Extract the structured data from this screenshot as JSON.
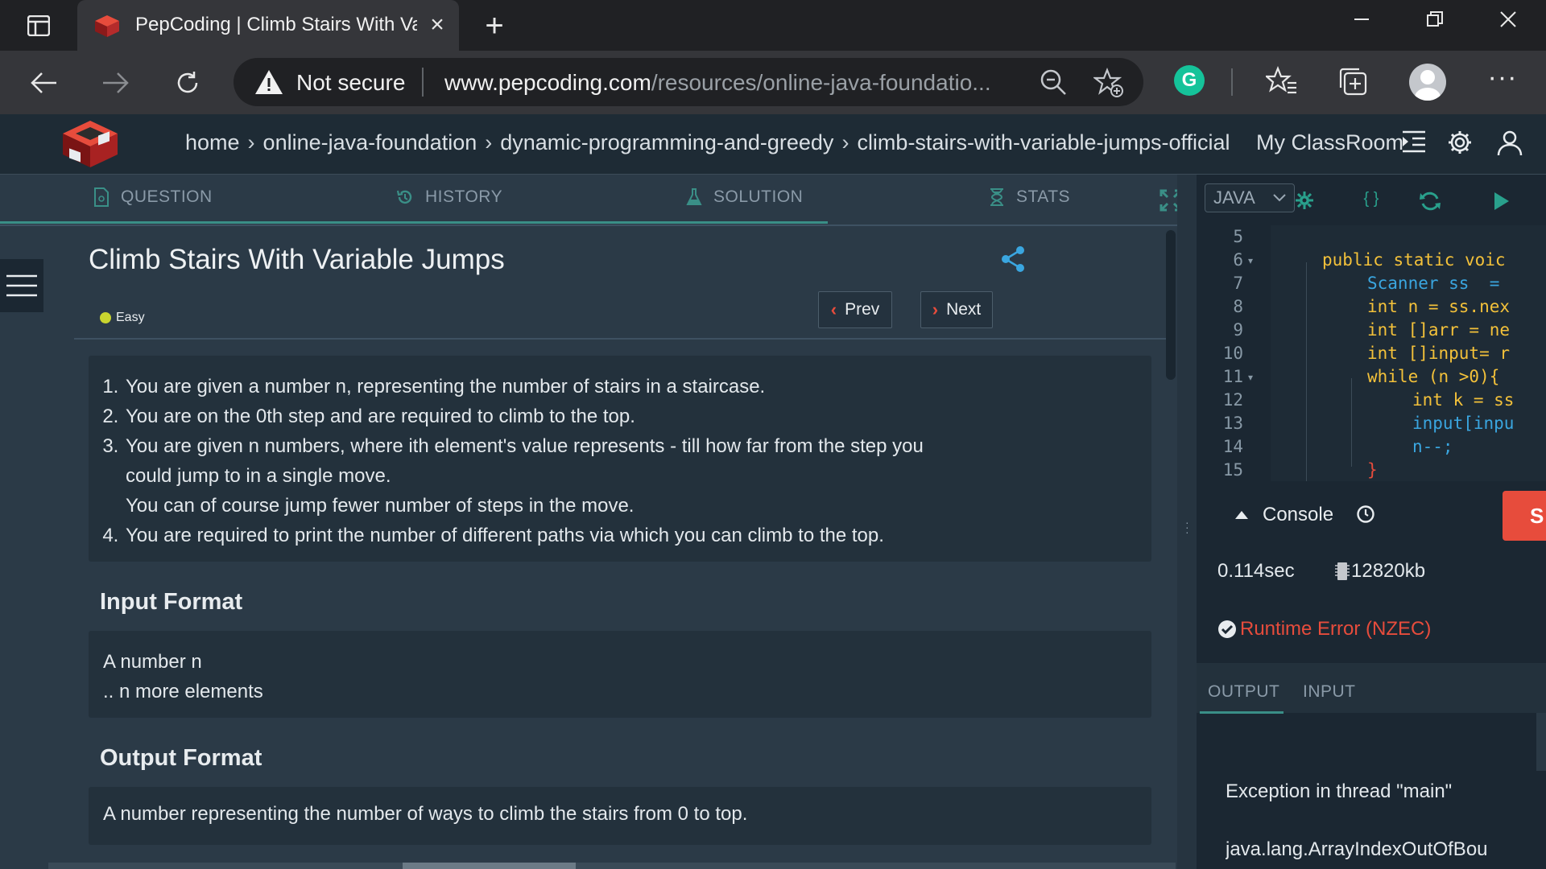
{
  "browser": {
    "tab_title": "PepCoding | Climb Stairs With Va",
    "security_label": "Not secure",
    "url_host": "www.pepcoding.com",
    "url_path": "/resources/online-java-foundatio..."
  },
  "site": {
    "breadcrumb": [
      "home",
      "online-java-foundation",
      "dynamic-programming-and-greedy",
      "climb-stairs-with-variable-jumps-official"
    ],
    "classroom_label": "My ClassRoom"
  },
  "tabs": {
    "question": "QUESTION",
    "history": "HISTORY",
    "solution": "SOLUTION",
    "stats": "STATS"
  },
  "problem": {
    "title": "Climb Stairs With Variable Jumps",
    "difficulty": "Easy",
    "prev_label": "Prev",
    "next_label": "Next",
    "description": [
      "You are given a number n, representing the number of stairs in a staircase.",
      "You are on the 0th step and are required to climb to the top.",
      "You are given n numbers, where ith element's value represents - till how far from the step you",
      "could jump to in a single move.",
      "You can of course jump fewer number of steps in the move.",
      "You are required to print the number of different paths via which you can climb to the top."
    ],
    "input_heading": "Input Format",
    "input_lines": [
      "A number n",
      ".. n more elements"
    ],
    "output_heading": "Output Format",
    "output_text": "A number representing the number of ways to climb the stairs from 0 to top."
  },
  "editor": {
    "language": "JAVA",
    "line_numbers": [
      "5",
      "6",
      "7",
      "8",
      "9",
      "10",
      "11",
      "12",
      "13",
      "14",
      "15"
    ],
    "code_lines": [
      "",
      "public static voic",
      "Scanner ss  =",
      "int n = ss.nex",
      "int []arr = ne",
      "int []input= r",
      "while (n >0){",
      "int k = ss",
      "input[inpu",
      "n--;",
      "}"
    ]
  },
  "console": {
    "label": "Console",
    "submit_label": "S",
    "time": "0.114sec",
    "memory": "12820kb",
    "status": "Runtime Error (NZEC)",
    "output_tab": "OUTPUT",
    "input_tab": "INPUT",
    "output_lines": [
      "Exception in thread \"main\"",
      "java.lang.ArrayIndexOutOfBou"
    ]
  },
  "colors": {
    "accent": "#3a8f87",
    "error": "#e74c3c",
    "background": "#2b3a47"
  }
}
